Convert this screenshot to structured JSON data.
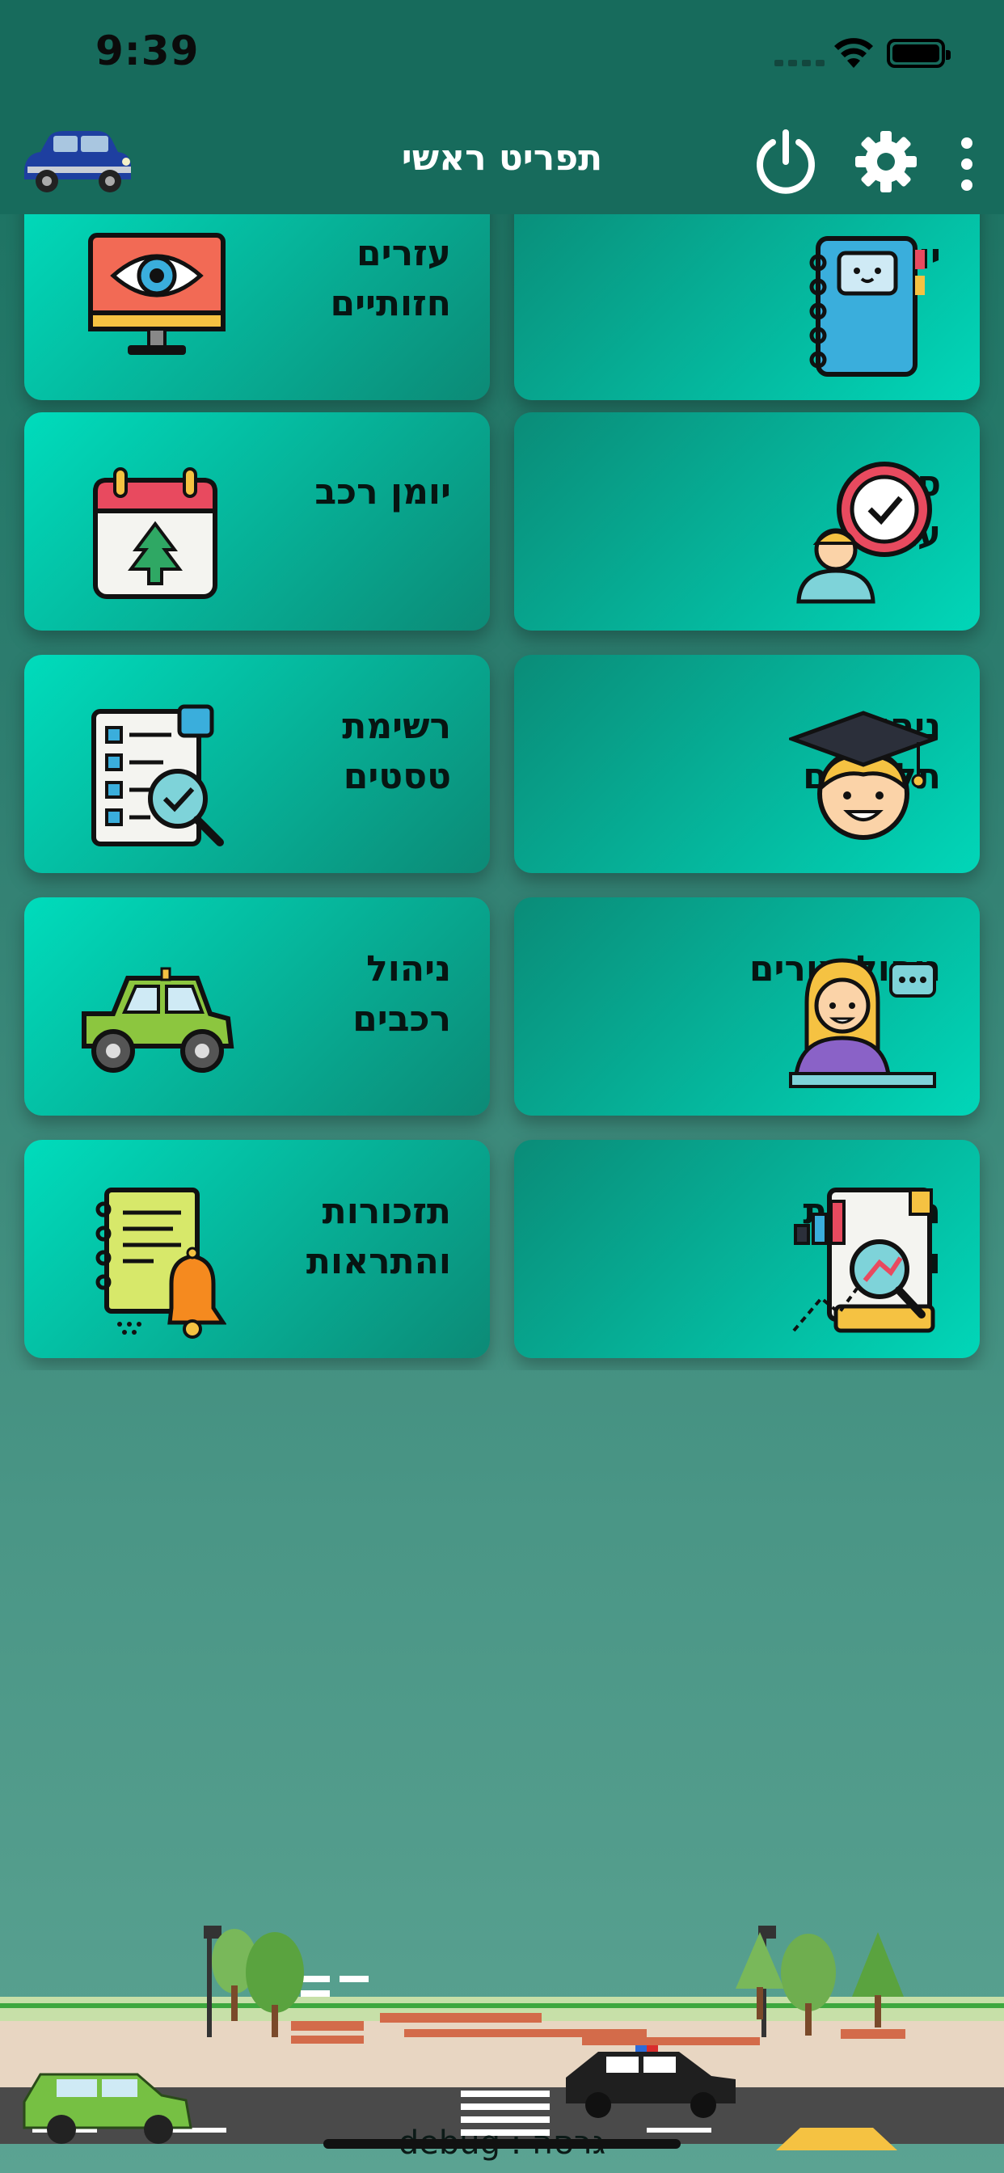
{
  "status_bar": {
    "time": "9:39"
  },
  "app_bar": {
    "title": "תפריט ראשי",
    "icons": [
      "car-logo",
      "power-icon",
      "gear-icon",
      "more-vertical-icon"
    ]
  },
  "menu": {
    "tiles": [
      {
        "label": "יומן",
        "icon": "notebook-icon"
      },
      {
        "label": "עזרים חזותיים",
        "icon": "monitor-eye-icon"
      },
      {
        "label": "סידור עבודה",
        "icon": "schedule-clock-icon"
      },
      {
        "label": "יומן רכב",
        "icon": "calendar-tree-icon"
      },
      {
        "label": "ניהול תלמידים",
        "icon": "graduate-student-icon"
      },
      {
        "label": "רשימת טסטים",
        "icon": "checklist-magnifier-icon"
      },
      {
        "label": "ניהול מורים",
        "icon": "teacher-icon"
      },
      {
        "label": "ניהול רכבים",
        "icon": "jeep-icon"
      },
      {
        "label": "חשבונות ודוחות",
        "icon": "report-chart-icon"
      },
      {
        "label": "תזכורות והתראות",
        "icon": "bell-notes-icon"
      }
    ]
  },
  "footer": {
    "debug_label": "גרסה : debug"
  },
  "colors": {
    "primary": "#176b5c",
    "tile_light": "#01d6b8",
    "tile_dark": "#0a8c78"
  }
}
